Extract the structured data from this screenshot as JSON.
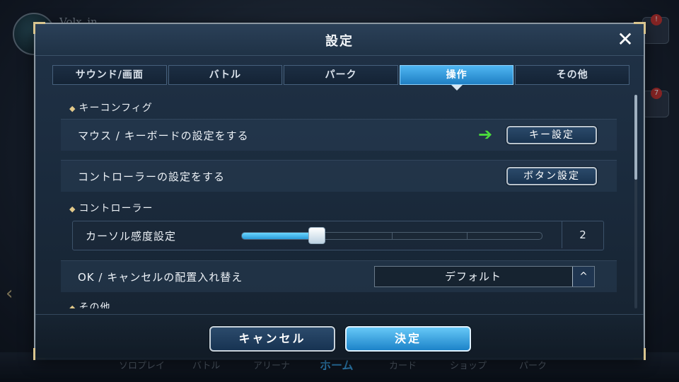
{
  "background": {
    "player_name": "Volx_in",
    "nav_items": [
      "ソロプレイ",
      "バトル",
      "アリーナ",
      "ホーム",
      "カード",
      "ショップ",
      "パーク"
    ],
    "badge_1": "!",
    "badge_2": "7"
  },
  "modal": {
    "title": "設定",
    "close_icon": "✕"
  },
  "tabs": [
    {
      "label": "サウンド/画面",
      "active": false
    },
    {
      "label": "バトル",
      "active": false
    },
    {
      "label": "パーク",
      "active": false
    },
    {
      "label": "操作",
      "active": true
    },
    {
      "label": "その他",
      "active": false
    }
  ],
  "sections": {
    "key_config": {
      "heading": "キーコンフィグ",
      "mouse_row": {
        "label": "マウス / キーボードの設定をする",
        "button": "キー設定"
      },
      "controller_row": {
        "label": "コントローラーの設定をする",
        "button": "ボタン設定"
      }
    },
    "controller": {
      "heading": "コントローラー",
      "sensitivity": {
        "label": "カーソル感度設定",
        "value": "2",
        "fill_fraction": 0.25
      },
      "swap": {
        "label": "OK / キャンセルの配置入れ替え",
        "selected": "デフォルト",
        "dropdown_icon": "^"
      }
    },
    "other": {
      "heading": "その他"
    }
  },
  "annotation_arrow": "➔",
  "footer": {
    "cancel": "キャンセル",
    "ok": "決定"
  },
  "colors": {
    "accent": "#2a9bd8",
    "active_tab": "#4fb6f2",
    "gold": "#e2c98a",
    "green_arrow": "#4bdb3c"
  }
}
